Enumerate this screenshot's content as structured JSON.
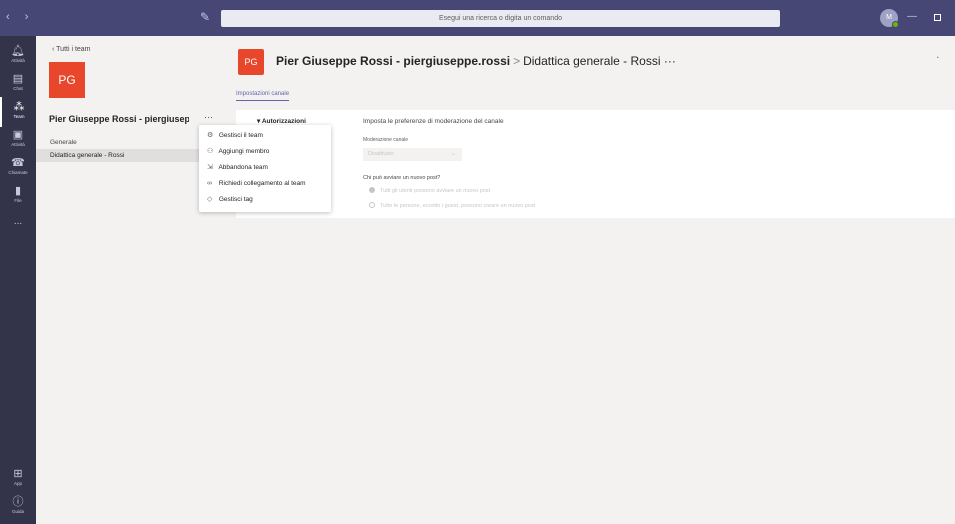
{
  "titlebar": {
    "nav_arrows": "‹ ›",
    "search_placeholder": "Esegui una ricerca o digita un comando",
    "avatar_initials": "M"
  },
  "appbar": {
    "items": [
      {
        "label": "Attività",
        "icon": "bell-icon"
      },
      {
        "label": "Chat",
        "icon": "chat-icon"
      },
      {
        "label": "Team",
        "icon": "teams-icon"
      },
      {
        "label": "Attività",
        "icon": "assignments-icon"
      },
      {
        "label": "Chiamate",
        "icon": "phone-icon"
      },
      {
        "label": "File",
        "icon": "file-icon"
      }
    ],
    "more": "...",
    "bottom": [
      {
        "label": "App",
        "icon": "apps-icon"
      },
      {
        "label": "Guida",
        "icon": "help-icon"
      }
    ]
  },
  "leftpanel": {
    "back_label": "Tutti i team",
    "team_initials": "PG",
    "team_name": "Pier Giuseppe Rossi - piergiusep...",
    "more": "···",
    "channels": [
      "Generale",
      "Didattica generale - Rossi"
    ]
  },
  "context_menu": {
    "items": [
      {
        "label": "Gestisci il team",
        "icon": "gear-icon"
      },
      {
        "label": "Aggiungi membro",
        "icon": "add-person-icon"
      },
      {
        "label": "Abbandona team",
        "icon": "leave-icon"
      },
      {
        "label": "Richiedi collegamento al team",
        "icon": "link-icon"
      },
      {
        "label": "Gestisci tag",
        "icon": "tag-icon"
      }
    ]
  },
  "main": {
    "team_initials": "PG",
    "team_title": "Pier Giuseppe Rossi - piergiuseppe.rossi",
    "separator": ">",
    "channel_title": "Didattica generale - Rossi ···",
    "tab": "Impostazioni canale",
    "permissions_heading": "Autorizzazioni",
    "pref_title": "Imposta le preferenze di moderazione del canale",
    "moderation_label": "Moderazione canale",
    "moderation_value": "Disattivato",
    "question": "Chi può avviare un nuovo post?",
    "options": [
      "Tutti gli utenti possono avviare un nuovo post",
      "Tutte le persone, eccetto i guest, possono creare un nuovo post"
    ]
  }
}
